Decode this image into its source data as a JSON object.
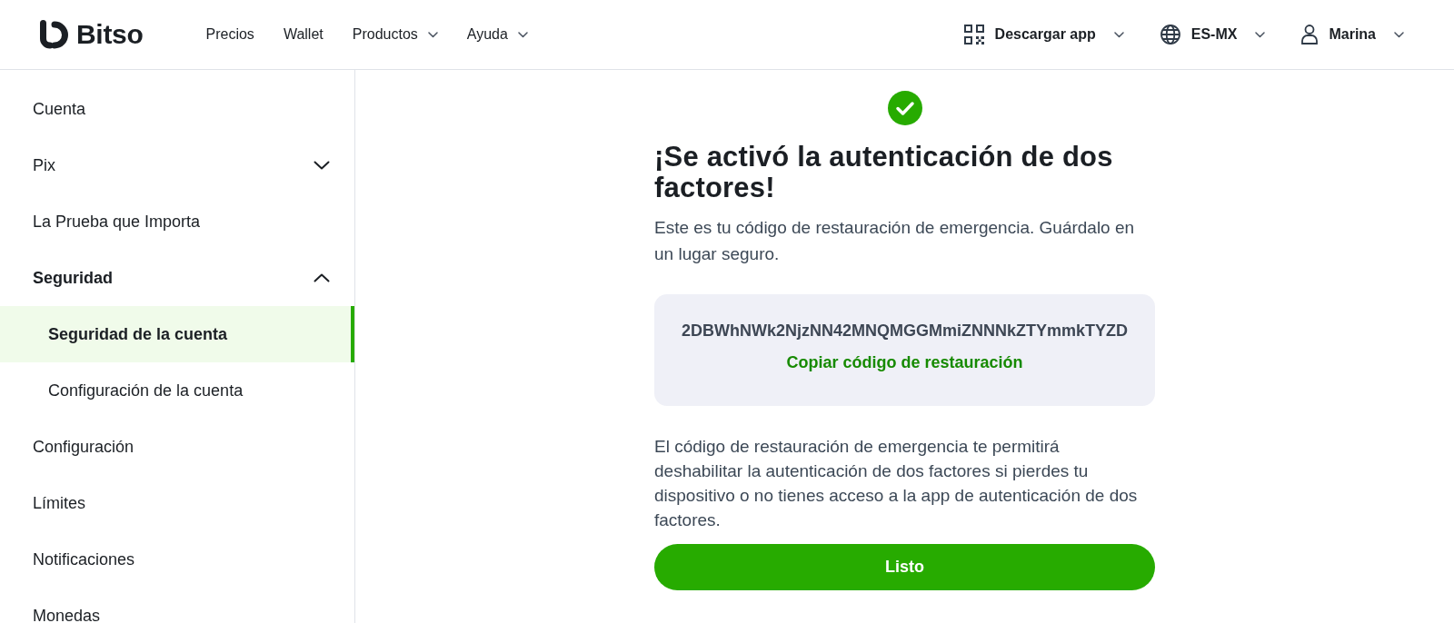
{
  "header": {
    "brand": "Bitso",
    "nav": [
      {
        "label": "Precios",
        "kind": "link"
      },
      {
        "label": "Wallet",
        "kind": "link"
      },
      {
        "label": "Productos",
        "kind": "menu"
      },
      {
        "label": "Ayuda",
        "kind": "menu"
      }
    ],
    "actions": [
      {
        "kind": "qr",
        "label": "Descargar app"
      },
      {
        "kind": "language",
        "label": "ES-MX"
      },
      {
        "kind": "account",
        "label": "Marina"
      }
    ]
  },
  "sidebar": {
    "items": [
      {
        "kind": "link",
        "label": "Cuenta",
        "selected": false
      },
      {
        "kind": "group",
        "label": "Pix",
        "selected": false,
        "expanded": false
      },
      {
        "kind": "link",
        "label": "La Prueba que Importa",
        "selected": false
      },
      {
        "kind": "group",
        "label": "Seguridad",
        "selected": false,
        "expanded": true,
        "children": [
          {
            "label": "Seguridad de la cuenta",
            "selected": true
          },
          {
            "label": "Configuración de la cuenta",
            "selected": false
          }
        ]
      },
      {
        "kind": "link",
        "label": "Configuración",
        "selected": false
      },
      {
        "kind": "link",
        "label": "Límites",
        "selected": false
      },
      {
        "kind": "link",
        "label": "Notificaciones",
        "selected": false
      },
      {
        "kind": "link",
        "label": "Monedas",
        "selected": false
      }
    ]
  },
  "main": {
    "title": "¡Se activó la autenticación de dos factores!",
    "intro": "Este es tu código de restauración de emergencia. Guárdalo en un lugar seguro.",
    "recovery_code": "2DBWhNWk2NjzNN42MNQMGGMmiZNNNkZTYmmkTYZD",
    "copy_link": "Copiar código de restauración",
    "note": "El código de restauración de emergencia te permitirá deshabilitar la autenticación de dos factores si pierdes tu dispositivo o no tienes acceso a la app de autenticación de dos factores.",
    "button": "Listo"
  }
}
